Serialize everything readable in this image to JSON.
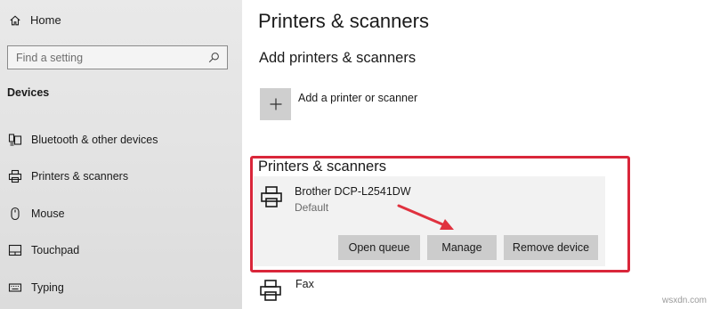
{
  "sidebar": {
    "home_label": "Home",
    "search_placeholder": "Find a setting",
    "section_label": "Devices",
    "items": [
      {
        "label": "Bluetooth & other devices",
        "icon": "bluetooth-devices-icon"
      },
      {
        "label": "Printers & scanners",
        "icon": "printer-icon"
      },
      {
        "label": "Mouse",
        "icon": "mouse-icon"
      },
      {
        "label": "Touchpad",
        "icon": "touchpad-icon"
      },
      {
        "label": "Typing",
        "icon": "keyboard-icon"
      }
    ]
  },
  "main": {
    "page_title": "Printers & scanners",
    "add_section_title": "Add printers & scanners",
    "add_label": "Add a printer or scanner",
    "list_section_title": "Printers & scanners",
    "printers": [
      {
        "name": "Brother DCP-L2541DW",
        "status": "Default"
      },
      {
        "name": "Fax",
        "status": ""
      }
    ],
    "buttons": {
      "open_queue": "Open queue",
      "manage": "Manage",
      "remove_device": "Remove device"
    }
  },
  "watermark": "wsxdn.com",
  "colors": {
    "highlight": "#d9263a",
    "arrow": "#e0323f",
    "button_bg": "#cccccc",
    "card_bg": "#f2f2f2"
  }
}
